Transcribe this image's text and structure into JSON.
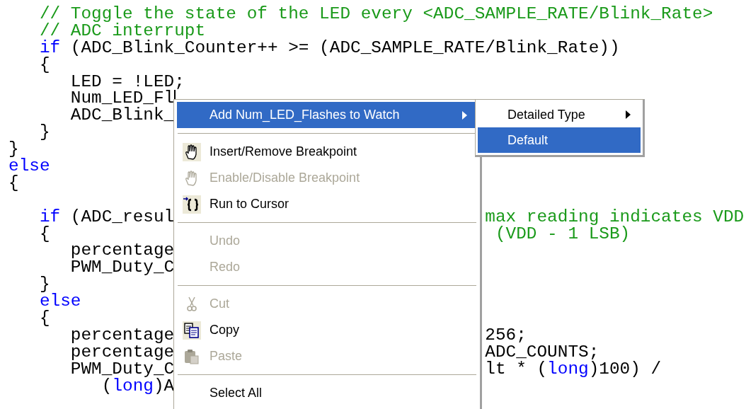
{
  "editor": {
    "lines": [
      {
        "left": [
          {
            "kind": "comment",
            "text": "   // Toggle the state of the LED every <ADC_SAMPLE_RATE/Blink_Rate>"
          }
        ]
      },
      {
        "left": [
          {
            "kind": "comment",
            "text": "   // ADC interrupt"
          }
        ]
      },
      {
        "left": [
          {
            "kind": "keyword",
            "text": "   if"
          },
          {
            "kind": "code",
            "text": " (ADC_Blink_Counter++ >= (ADC_SAMPLE_RATE/Blink_Rate))"
          }
        ]
      },
      {
        "left": [
          {
            "kind": "code",
            "text": "   {"
          }
        ]
      },
      {
        "left": [
          {
            "kind": "code",
            "text": "      LED = !LED;"
          }
        ]
      },
      {
        "left": [
          {
            "kind": "code",
            "text": "      Num_LED_Fl"
          }
        ],
        "caret": true
      },
      {
        "left": [
          {
            "kind": "code",
            "text": "      ADC_Blink_"
          }
        ]
      },
      {
        "left": [
          {
            "kind": "code",
            "text": "   }"
          }
        ]
      },
      {
        "left": [
          {
            "kind": "code",
            "text": "}"
          }
        ]
      },
      {
        "left": [
          {
            "kind": "keyword",
            "text": "else"
          }
        ]
      },
      {
        "left": [
          {
            "kind": "code",
            "text": "{"
          }
        ]
      },
      {
        "blank": true
      },
      {
        "left": [
          {
            "kind": "keyword",
            "text": "   if"
          },
          {
            "kind": "code",
            "text": " (ADC_resul"
          }
        ],
        "right": [
          {
            "kind": "comment",
            "text": "max reading indicates VDD"
          }
        ]
      },
      {
        "left": [
          {
            "kind": "code",
            "text": "   {"
          }
        ],
        "right": [
          {
            "kind": "comment",
            "text": " (VDD - 1 LSB)"
          }
        ]
      },
      {
        "left": [
          {
            "kind": "code",
            "text": "      percentage"
          }
        ]
      },
      {
        "left": [
          {
            "kind": "code",
            "text": "      PWM_Duty_C"
          }
        ]
      },
      {
        "left": [
          {
            "kind": "code",
            "text": "   }"
          }
        ]
      },
      {
        "left": [
          {
            "kind": "keyword",
            "text": "   else"
          }
        ]
      },
      {
        "left": [
          {
            "kind": "code",
            "text": "   {"
          }
        ]
      },
      {
        "left": [
          {
            "kind": "code",
            "text": "      percentage"
          }
        ],
        "right": [
          {
            "kind": "code",
            "text": "256;"
          }
        ]
      },
      {
        "left": [
          {
            "kind": "code",
            "text": "      percentage"
          }
        ],
        "right": [
          {
            "kind": "code",
            "text": "ADC_COUNTS;"
          }
        ]
      },
      {
        "left": [
          {
            "kind": "code",
            "text": "      PWM_Duty_C"
          }
        ],
        "right": [
          {
            "kind": "code",
            "text": "lt * ("
          },
          {
            "kind": "keyword",
            "text": "long"
          },
          {
            "kind": "code",
            "text": ")100) /"
          }
        ]
      },
      {
        "left": [
          {
            "kind": "code",
            "text": "         ("
          },
          {
            "kind": "keyword",
            "text": "long"
          },
          {
            "kind": "code",
            "text": ")A"
          }
        ]
      }
    ]
  },
  "context_menu": {
    "items": [
      {
        "kind": "item",
        "label": "Add Num_LED_Flashes to Watch",
        "disabled": false,
        "selected": true,
        "submenu": true
      },
      {
        "kind": "separator"
      },
      {
        "kind": "item",
        "label": "Insert/Remove Breakpoint",
        "disabled": false,
        "selected": false,
        "submenu": false
      },
      {
        "kind": "item",
        "label": "Enable/Disable Breakpoint",
        "disabled": true,
        "selected": false,
        "submenu": false
      },
      {
        "kind": "item",
        "label": "Run to Cursor",
        "disabled": false,
        "selected": false,
        "submenu": false
      },
      {
        "kind": "separator"
      },
      {
        "kind": "item",
        "label": "Undo",
        "disabled": true,
        "selected": false,
        "submenu": false
      },
      {
        "kind": "item",
        "label": "Redo",
        "disabled": true,
        "selected": false,
        "submenu": false
      },
      {
        "kind": "separator"
      },
      {
        "kind": "item",
        "label": "Cut",
        "disabled": true,
        "selected": false,
        "submenu": false
      },
      {
        "kind": "item",
        "label": "Copy",
        "disabled": false,
        "selected": false,
        "submenu": false
      },
      {
        "kind": "item",
        "label": "Paste",
        "disabled": true,
        "selected": false,
        "submenu": false
      },
      {
        "kind": "separator"
      },
      {
        "kind": "item",
        "label": "Select All",
        "disabled": false,
        "selected": false,
        "submenu": false
      }
    ]
  },
  "submenu": {
    "items": [
      {
        "label": "Detailed Type",
        "selected": false,
        "submenu": true
      },
      {
        "label": "Default",
        "selected": true,
        "submenu": false
      }
    ]
  }
}
